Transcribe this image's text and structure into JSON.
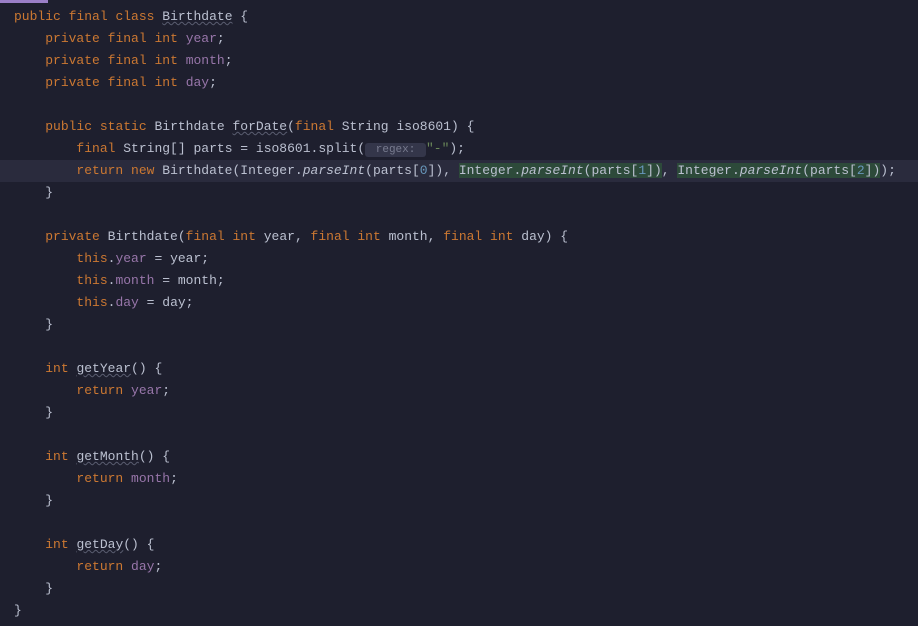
{
  "code": {
    "l1": {
      "kw1": "public",
      "kw2": "final",
      "kw3": "class",
      "name": "Birthdate",
      "brace": " {"
    },
    "l2": {
      "kw1": "private",
      "kw2": "final",
      "type": "int",
      "field": "year",
      "end": ";"
    },
    "l3": {
      "kw1": "private",
      "kw2": "final",
      "type": "int",
      "field": "month",
      "end": ";"
    },
    "l4": {
      "kw1": "private",
      "kw2": "final",
      "type": "int",
      "field": "day",
      "end": ";"
    },
    "l6": {
      "kw1": "public",
      "kw2": "static",
      "ret": "Birthdate",
      "name": "forDate",
      "open": "(",
      "kw3": "final",
      "ptype": "String",
      "pname": "iso8601",
      "close": ") {"
    },
    "l7": {
      "kw1": "final",
      "type": "String[]",
      "var": "parts",
      "eq": " = ",
      "obj": "iso8601",
      "dot": ".",
      "method": "split",
      "open": "(",
      "hint": " regex: ",
      "str": "\"-\"",
      "close": ");"
    },
    "l8": {
      "kw1": "return",
      "kw2": "new",
      "ctor": "Birthdate",
      "open": "(",
      "cls1": "Integer",
      "dot": ".",
      "m": "parseInt",
      "p": "parts",
      "ob": "[",
      "n0": "0",
      "cb": "]",
      "cp": ")",
      "comma": ", ",
      "n1": "1",
      "n2": "2",
      "end": ");"
    },
    "l9": {
      "brace": "}"
    },
    "l11": {
      "kw1": "private",
      "ctor": "Birthdate",
      "open": "(",
      "kw2": "final",
      "t1": "int",
      "p1": "year",
      "c": ", ",
      "p2": "month",
      "p3": "day",
      "close": ") {"
    },
    "l12": {
      "this": "this",
      "dot": ".",
      "field": "year",
      "eq": " = ",
      "param": "year",
      "end": ";"
    },
    "l13": {
      "this": "this",
      "dot": ".",
      "field": "month",
      "eq": " = ",
      "param": "month",
      "end": ";"
    },
    "l14": {
      "this": "this",
      "dot": ".",
      "field": "day",
      "eq": " = ",
      "param": "day",
      "end": ";"
    },
    "l15": {
      "brace": "}"
    },
    "l17": {
      "type": "int",
      "name": "getYear",
      "parens": "() {"
    },
    "l18": {
      "kw": "return",
      "field": "year",
      "end": ";"
    },
    "l19": {
      "brace": "}"
    },
    "l21": {
      "type": "int",
      "name": "getMonth",
      "parens": "() {"
    },
    "l22": {
      "kw": "return",
      "field": "month",
      "end": ";"
    },
    "l23": {
      "brace": "}"
    },
    "l25": {
      "type": "int",
      "name": "getDay",
      "parens": "() {"
    },
    "l26": {
      "kw": "return",
      "field": "day",
      "end": ";"
    },
    "l27": {
      "brace": "}"
    },
    "l28": {
      "brace": "}"
    }
  }
}
